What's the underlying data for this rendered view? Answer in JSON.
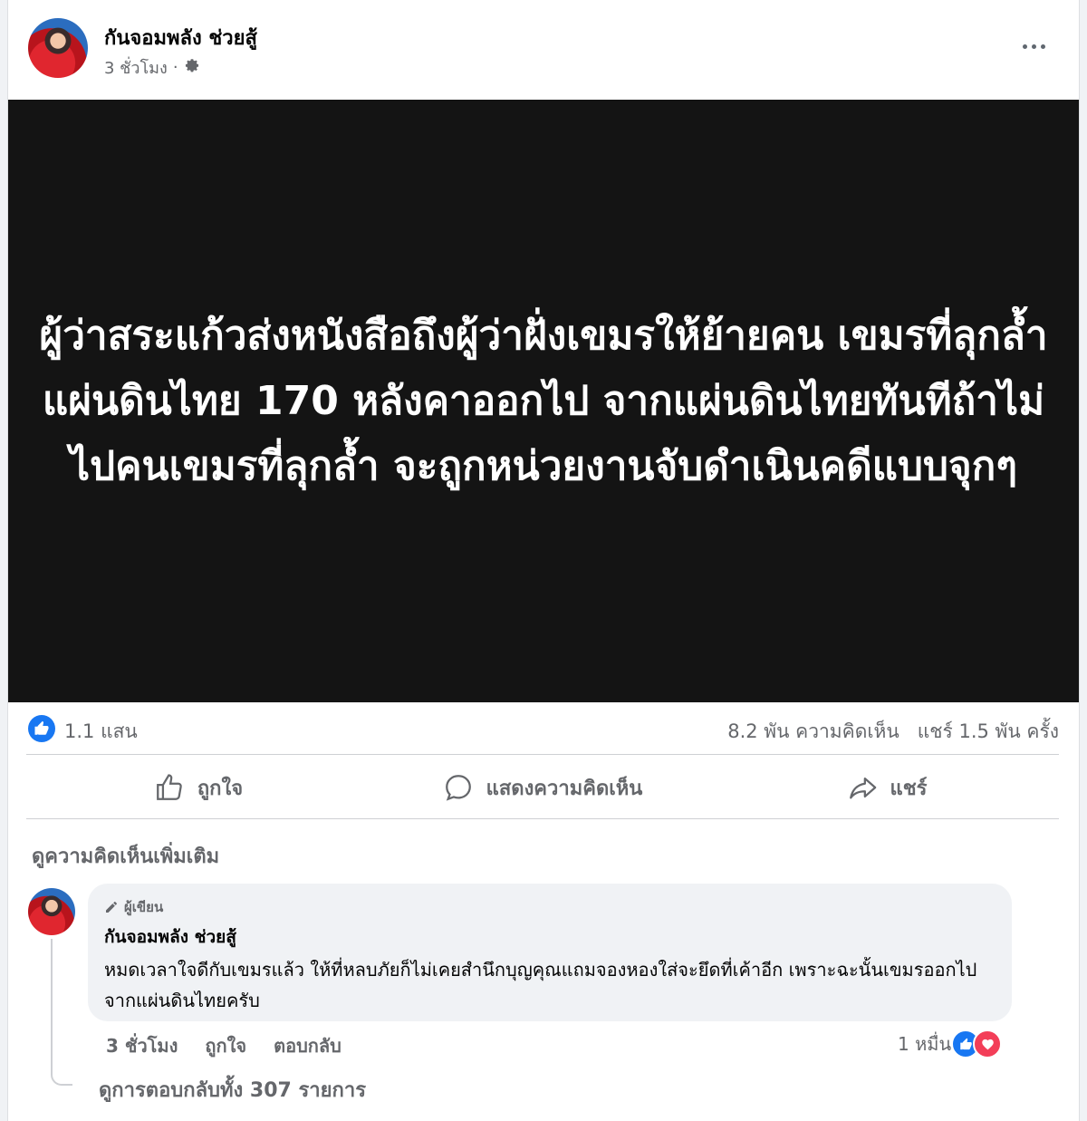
{
  "post": {
    "author": "กันจอมพลัง ช่วยสู้",
    "time": "3 ชั่วโมง",
    "separator": "·",
    "image_text": "ผู้ว่าสระแก้วส่งหนังสือถึงผู้ว่าฝั่งเขมรให้ย้ายคน เขมรที่ลุกล้ำแผ่นดินไทย 170 หลังคาออกไป จากแผ่นดินไทยทันทีถ้าไม่ไปคนเขมรที่ลุกล้ำ จะถูกหน่วยงานจับดำเนินคดีแบบจุกๆ"
  },
  "stats": {
    "reactions": "1.1 แสน",
    "comments": "8.2 พัน ความคิดเห็น",
    "shares": "แชร์ 1.5 พัน ครั้ง"
  },
  "actions": {
    "like": "ถูกใจ",
    "comment": "แสดงความคิดเห็น",
    "share": "แชร์"
  },
  "comments_section": {
    "view_more": "ดูความคิดเห็นเพิ่มเติม",
    "comment": {
      "badge": "ผู้เขียน",
      "author": "กันจอมพลัง ช่วยสู้",
      "text": "หมดเวลาใจดีกับเขมรแล้ว ให้ที่หลบภัยก็ไม่เคยสำนึกบุญคุณแถมจองหองใส่จะยึดที่เค้าอีก เพราะฉะนั้นเขมรออกไปจากแผ่นดินไทยครับ",
      "time": "3 ชั่วโมง",
      "like": "ถูกใจ",
      "reply": "ตอบกลับ",
      "reaction_count": "1 หมื่น"
    },
    "view_replies": "ดูการตอบกลับทั้ง 307 รายการ"
  },
  "colors": {
    "accent": "#1877f2",
    "love": "#f33e58",
    "muted": "#65676b"
  }
}
